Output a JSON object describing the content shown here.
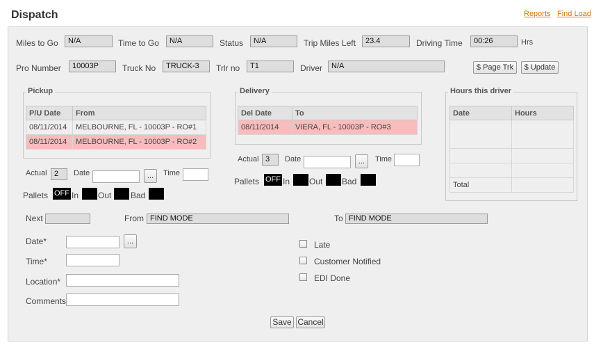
{
  "header": {
    "title": "Dispatch",
    "reports_link": "Reports",
    "find_load_link": "Find Load"
  },
  "summary": {
    "miles_to_go": {
      "label": "Miles to Go",
      "value": "N/A"
    },
    "time_to_go": {
      "label": "Time to Go",
      "value": "N/A"
    },
    "status": {
      "label": "Status",
      "value": "N/A"
    },
    "trip_miles_left": {
      "label": "Trip Miles Left",
      "value": "23.4"
    },
    "driving_time": {
      "label": "Driving Time",
      "value": "00:26",
      "unit": "Hrs"
    },
    "pro_number": {
      "label": "Pro Number",
      "value": "10003P"
    },
    "truck_no": {
      "label": "Truck No",
      "value": "TRUCK-3"
    },
    "trlr_no": {
      "label": "Trlr no",
      "value": "T1"
    },
    "driver": {
      "label": "Driver",
      "value": "N/A"
    },
    "page_trk_button": "$ Page Trk",
    "update_button": "$ Update"
  },
  "pickup": {
    "legend": "Pickup",
    "columns": [
      "P/U Date",
      "From"
    ],
    "rows": [
      {
        "date": "08/11/2014",
        "from": "MELBOURNE, FL - 10003P - RO#1",
        "highlighted": false
      },
      {
        "date": "08/11/2014",
        "from": "MELBOURNE, FL - 10003P - RO#2",
        "highlighted": true
      }
    ],
    "actual_label": "Actual",
    "actual_value": "2",
    "date_label": "Date",
    "date_value": "",
    "picker_label": "...",
    "time_label": "Time",
    "time_value": "",
    "pallets_label": "Pallets",
    "pallets_toggle": "OFF",
    "in_label": "In",
    "out_label": "Out",
    "bad_label": "Bad"
  },
  "delivery": {
    "legend": "Delivery",
    "columns": [
      "Del Date",
      "To"
    ],
    "rows": [
      {
        "date": "08/11/2014",
        "to": "VIERA, FL - 10003P - RO#3",
        "highlighted": true
      }
    ],
    "actual_label": "Actual",
    "actual_value": "3",
    "date_label": "Date",
    "date_value": "",
    "picker_label": "...",
    "time_label": "Time",
    "time_value": "",
    "pallets_label": "Pallets",
    "pallets_toggle": "OFF",
    "in_label": "In",
    "out_label": "Out",
    "bad_label": "Bad"
  },
  "hours": {
    "legend": "Hours this driver",
    "columns": [
      "Date",
      "Hours"
    ],
    "total_label": "Total"
  },
  "next": {
    "next_label": "Next",
    "next_value": "",
    "from_label": "From",
    "from_value": "FIND MODE",
    "to_label": "To",
    "to_value": "FIND MODE",
    "date_label": "Date*",
    "date_value": "",
    "picker_label": "...",
    "time_label": "Time*",
    "time_value": "",
    "location_label": "Location*",
    "location_value": "",
    "comments_label": "Comments",
    "comments_value": "",
    "late_label": "Late",
    "customer_notified_label": "Customer Notified",
    "edi_done_label": "EDI Done"
  },
  "actions": {
    "save": "Save",
    "cancel": "Cancel"
  }
}
